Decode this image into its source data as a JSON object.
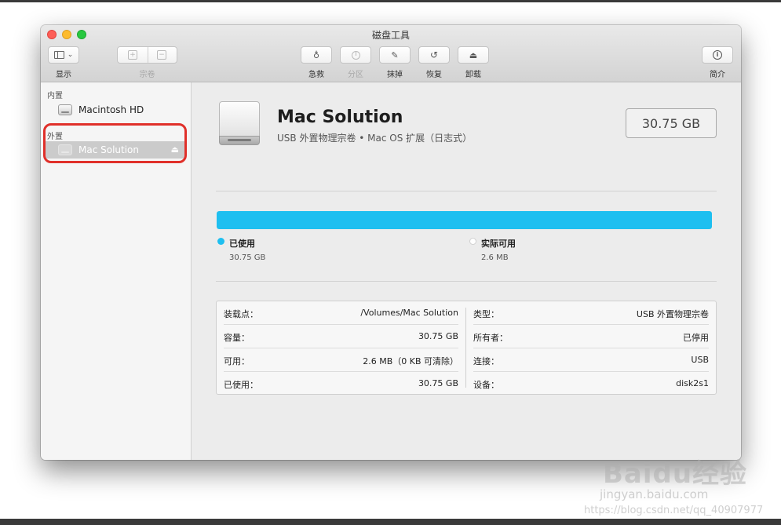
{
  "window": {
    "title": "磁盘工具"
  },
  "toolbar": {
    "view_label": "显示",
    "volume_label": "宗卷",
    "first_aid_label": "急救",
    "partition_label": "分区",
    "erase_label": "抹掉",
    "restore_label": "恢复",
    "unmount_label": "卸载",
    "info_label": "简介"
  },
  "sidebar": {
    "internal_title": "内置",
    "internal_disk": "Macintosh HD",
    "external_title": "外置",
    "external_disk": "Mac Solution"
  },
  "volume": {
    "name": "Mac Solution",
    "subtitle": "USB 外置物理宗卷 • Mac OS 扩展（日志式）",
    "size": "30.75 GB",
    "used_fraction": 1.0
  },
  "usage": {
    "used_label": "已使用",
    "used_value": "30.75 GB",
    "used_color": "#1ebff0",
    "free_label": "实际可用",
    "free_value": "2.6 MB",
    "free_color": "#ffffff"
  },
  "info": {
    "left": [
      {
        "key": "装载点：",
        "value": "/Volumes/Mac Solution"
      },
      {
        "key": "容量：",
        "value": "30.75 GB"
      },
      {
        "key": "可用：",
        "value": "2.6 MB（0 KB 可清除）"
      },
      {
        "key": "已使用：",
        "value": "30.75 GB"
      }
    ],
    "right": [
      {
        "key": "类型：",
        "value": "USB 外置物理宗卷"
      },
      {
        "key": "所有者：",
        "value": "已停用"
      },
      {
        "key": "连接：",
        "value": "USB"
      },
      {
        "key": "设备：",
        "value": "disk2s1"
      }
    ]
  },
  "watermark": {
    "logo": "Baidu经验",
    "domain": "jingyan.baidu.com",
    "url": "https://blog.csdn.net/qq_40907977"
  }
}
